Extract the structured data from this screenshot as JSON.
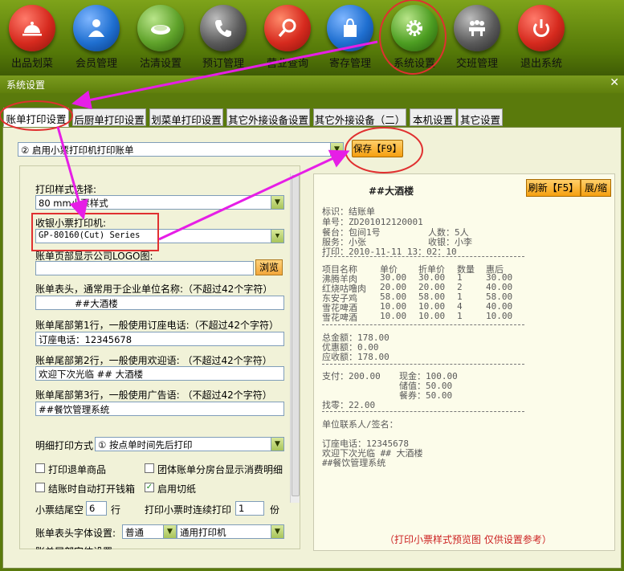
{
  "toolbar": {
    "items": [
      {
        "label": "出品划菜",
        "icon": "cloche-icon",
        "color": "#d62a1e"
      },
      {
        "label": "会员管理",
        "icon": "user-icon",
        "color": "#1f6fd0"
      },
      {
        "label": "沽清设置",
        "icon": "plate-icon",
        "color": "#5fa22a"
      },
      {
        "label": "预订管理",
        "icon": "phone-icon",
        "color": "#5a5a5a"
      },
      {
        "label": "营业查询",
        "icon": "magnifier-icon",
        "color": "#d62a1e"
      },
      {
        "label": "寄存管理",
        "icon": "bag-icon",
        "color": "#1f6fd0"
      },
      {
        "label": "系统设置",
        "icon": "gear-icon",
        "color": "#4d9e22"
      },
      {
        "label": "交班管理",
        "icon": "meeting-icon",
        "color": "#5a5a5a"
      },
      {
        "label": "退出系统",
        "icon": "power-icon",
        "color": "#d62a1e"
      }
    ]
  },
  "window": {
    "title": "系统设置",
    "close": "✕"
  },
  "tabs": [
    "账单打印设置",
    "后厨单打印设置",
    "划菜单打印设置",
    "其它外接设备设置",
    "其它外接设备（二）",
    "本机设置",
    "其它设置"
  ],
  "top": {
    "print_mode": "② 启用小票打印机打印账单",
    "save_label": "保存【F9】"
  },
  "form": {
    "style_label": "打印样式选择:",
    "style_value": "80  mm小票样式",
    "printer_label": "收银小票打印机:",
    "printer_value": "GP-80160(Cut) Series",
    "logo_label": "账单页部显示公司LOGO图:",
    "browse_label": "浏览",
    "header_label": "账单表头，通常用于企业单位名称:（不超过42个字符）",
    "header_value": "##大酒楼",
    "footer1_label": "账单尾部第1行，一般使用订座电话:（不超过42个字符）",
    "footer1_value": "订座电话：12345678",
    "footer2_label": "账单尾部第2行，一般使用欢迎语:  （不超过42个字符）",
    "footer2_value": "欢迎下次光临 ## 大酒楼",
    "footer3_label": "账单尾部第3行，一般使用广告语:  （不超过42个字符）",
    "footer3_value": "##餐饮管理系统",
    "detail_label": "明细打印方式",
    "detail_value": "① 按点单时间先后打印",
    "cb1": "打印退单商品",
    "cb2": "团体账单分房台显示消费明细",
    "cb3": "结账时自动打开钱箱",
    "cb4": "启用切纸",
    "tail_label": "小票结尾空",
    "tail_value": "6",
    "tail_unit": "行",
    "cont_label": "打印小票时连续打印",
    "cont_value": "1",
    "cont_unit": "份",
    "font_label": "账单表头字体设置:",
    "font_value": "普通",
    "font_printer": "通用打印机",
    "cut_label": "账单尾部字体设置"
  },
  "preview": {
    "refresh_label": "刷新【F5】",
    "expand_label": "展/缩",
    "title": "##大酒楼",
    "info": [
      "标识：结账单",
      "单号：ZD201012120001",
      "餐台：包间1号",
      "服务：小张",
      "打印：2010-11-11 13：02：10"
    ],
    "info_right": [
      "人数：5人",
      "收银：小李"
    ],
    "item_header": [
      "项目名称",
      "单价",
      "折单价",
      "数量",
      "惠后"
    ],
    "items": [
      [
        "沸腾羊肉",
        "30.00",
        "30.00",
        "1",
        "30.00"
      ],
      [
        "红烧咕噜肉",
        "20.00",
        "20.00",
        "2",
        "40.00"
      ],
      [
        "东安子鸡",
        "58.00",
        "58.00",
        "1",
        "58.00"
      ],
      [
        "雪花啤酒",
        "10.00",
        "10.00",
        "4",
        "40.00"
      ],
      [
        "雪花啤酒",
        "10.00",
        "10.00",
        "1",
        "10.00"
      ]
    ],
    "totals": [
      "总金额：178.00",
      "优惠额：0.00",
      "应收额：178.00"
    ],
    "pay_left": "支付：200.00",
    "pay_right": [
      "现金：100.00",
      "储值：50.00",
      "餐券：50.00"
    ],
    "change": "找零：22.00",
    "sign": "单位联系人/签名：",
    "footer": [
      "订座电话：12345678",
      "欢迎下次光临 ## 大酒楼",
      "##餐饮管理系统"
    ],
    "note": "（打印小票样式预览图 仅供设置参考）"
  },
  "colors": {
    "note": "#cc2222",
    "annotation": "#e61ee6",
    "highlight": "#e03030"
  }
}
